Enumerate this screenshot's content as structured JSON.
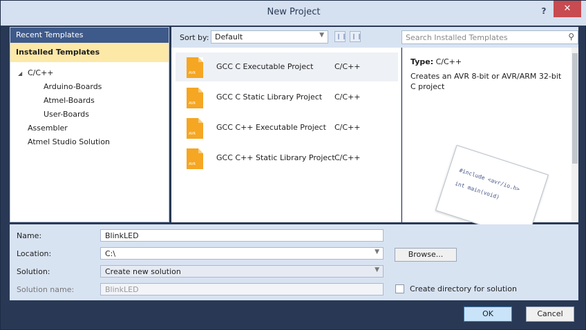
{
  "window": {
    "title": "New Project",
    "help": "?",
    "close": "✕"
  },
  "left": {
    "recent_label": "Recent Templates",
    "installed_label": "Installed Templates",
    "tree": [
      {
        "label": "C/C++",
        "level": 0,
        "expanded": true
      },
      {
        "label": "Arduino-Boards",
        "level": 1
      },
      {
        "label": "Atmel-Boards",
        "level": 1
      },
      {
        "label": "User-Boards",
        "level": 1
      },
      {
        "label": "Assembler",
        "level": 0
      },
      {
        "label": "Atmel Studio Solution",
        "level": 0
      }
    ]
  },
  "toolbar": {
    "sort_label": "Sort by:",
    "sort_value": "Default"
  },
  "search": {
    "placeholder": "Search Installed Templates"
  },
  "templates": [
    {
      "name": "GCC C Executable Project",
      "type": "C/C++",
      "selected": true
    },
    {
      "name": "GCC C Static Library Project",
      "type": "C/C++"
    },
    {
      "name": "GCC C++ Executable Project",
      "type": "C/C++"
    },
    {
      "name": "GCC C++ Static Library Project",
      "type": "C/C++"
    }
  ],
  "details": {
    "type_label": "Type:",
    "type_value": "C/C++",
    "description": "Creates an AVR 8-bit or AVR/ARM 32-bit C project",
    "code_line1": "#include <avr/io.h>",
    "code_line2": "int main(void)"
  },
  "form": {
    "name_label": "Name:",
    "name_value": "BlinkLED",
    "location_label": "Location:",
    "location_value": "C:\\",
    "solution_label": "Solution:",
    "solution_value": "Create new solution",
    "solution_name_label": "Solution name:",
    "solution_name_value": "BlinkLED",
    "browse_label": "Browse...",
    "create_dir_label": "Create directory for solution"
  },
  "buttons": {
    "ok": "OK",
    "cancel": "Cancel"
  },
  "colors": {
    "accent": "#3e5a8a",
    "installed_highlight": "#fde9a7",
    "folder": "#f5a623",
    "close": "#c74b50"
  }
}
